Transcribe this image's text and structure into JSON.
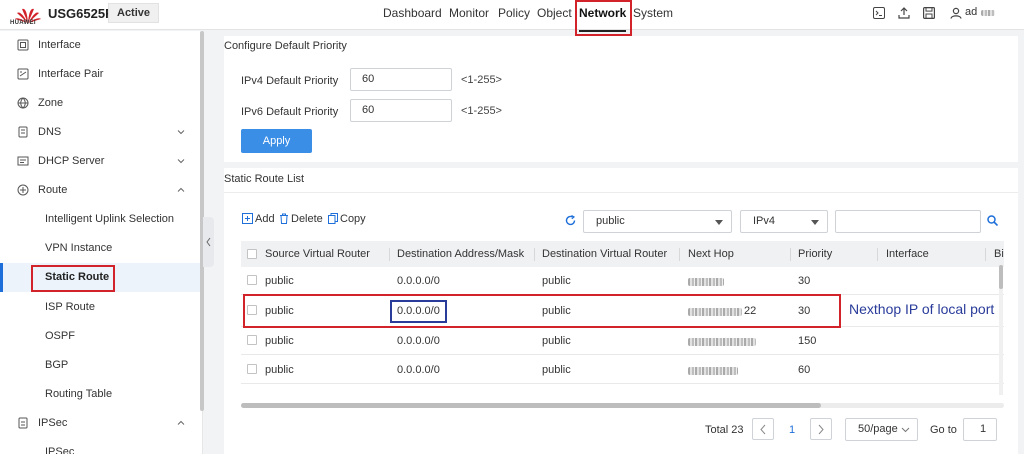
{
  "header": {
    "logo_text": "HUAWEI",
    "model": "USG6525F",
    "status_badge": "Active",
    "nav": [
      "Dashboard",
      "Monitor",
      "Policy",
      "Object",
      "Network",
      "System"
    ],
    "active_nav": "Network",
    "user": "ad",
    "icons": [
      "terminal-icon",
      "upload-icon",
      "save-icon",
      "user-icon"
    ]
  },
  "sidebar": {
    "items": [
      {
        "label": "Interface",
        "icon": "interface-icon"
      },
      {
        "label": "Interface Pair",
        "icon": "interface-pair-icon"
      },
      {
        "label": "Zone",
        "icon": "zone-icon"
      },
      {
        "label": "DNS",
        "icon": "dns-icon",
        "expandable": true
      },
      {
        "label": "DHCP Server",
        "icon": "dhcp-icon",
        "expandable": true
      },
      {
        "label": "Route",
        "icon": "route-icon",
        "expanded": true
      }
    ],
    "route_children": [
      "Intelligent Uplink Selection",
      "VPN Instance",
      "Static Route",
      "ISP Route",
      "OSPF",
      "BGP",
      "Routing Table"
    ],
    "selected": "Static Route",
    "ipsec": {
      "label": "IPSec",
      "icon": "ipsec-icon"
    },
    "ipsec_child": "IPSec"
  },
  "priority": {
    "title": "Configure Default Priority",
    "ipv4_label": "IPv4 Default Priority",
    "ipv4_value": "60",
    "ipv4_hint": "<1-255>",
    "ipv6_label": "IPv6 Default Priority",
    "ipv6_value": "60",
    "ipv6_hint": "<1-255>",
    "apply": "Apply"
  },
  "route_list": {
    "title": "Static Route List",
    "toolbar": {
      "add": "Add",
      "delete": "Delete",
      "copy": "Copy"
    },
    "vr_select": "public",
    "family_select": "IPv4",
    "search_value": "",
    "columns": [
      "Source Virtual Router",
      "Destination Address/Mask",
      "Destination Virtual Router",
      "Next Hop",
      "Priority",
      "Interface",
      "Bi"
    ],
    "rows": [
      {
        "src": "public",
        "dest": "0.0.0.0/0",
        "dvr": "public",
        "next_hop": "",
        "priority": "30"
      },
      {
        "src": "public",
        "dest": "0.0.0.0/0",
        "dvr": "public",
        "next_hop": "22",
        "priority": "30"
      },
      {
        "src": "public",
        "dest": "0.0.0.0/0",
        "dvr": "public",
        "next_hop": "",
        "priority": "150"
      },
      {
        "src": "public",
        "dest": "0.0.0.0/0",
        "dvr": "public",
        "next_hop": "",
        "priority": "60"
      }
    ],
    "annotation": "Nexthop IP of local port"
  },
  "pagination": {
    "total": "Total 23",
    "page": "1",
    "page_size": "50/page",
    "goto_label": "Go to",
    "goto_value": "1"
  },
  "colors": {
    "accent": "#3a8ee6",
    "highlight_red": "#d3232a",
    "annotation_blue": "#2a3c9a"
  }
}
